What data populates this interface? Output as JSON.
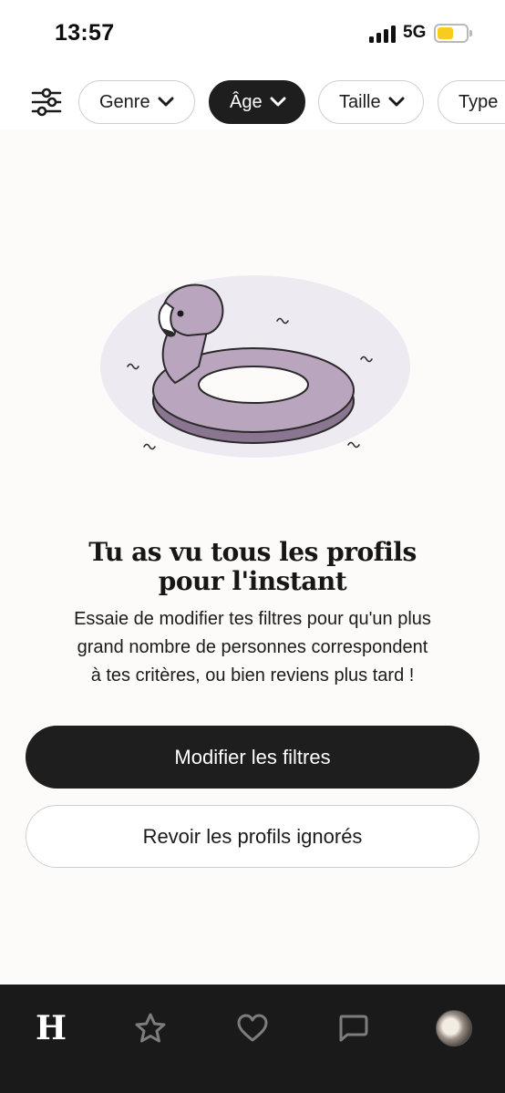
{
  "status_bar": {
    "time": "13:57",
    "network": "5G",
    "battery_level": 0.55,
    "battery_color": "#f6cc1d"
  },
  "filters": {
    "settings_icon": "sliders-icon",
    "chips": [
      {
        "label": "Genre",
        "active": false
      },
      {
        "label": "Âge",
        "active": true
      },
      {
        "label": "Taille",
        "active": false
      },
      {
        "label": "Type",
        "active": false
      }
    ]
  },
  "empty_state": {
    "illustration": "flamingo-float-illustration",
    "headline_line1": "Tu as vu tous les profils",
    "headline_line2": "pour l'instant",
    "body_line1": "Essaie de modifier tes filtres pour qu'un plus",
    "body_line2": "grand nombre de personnes correspondent",
    "body_line3": "à tes critères, ou bien reviens plus tard !",
    "primary_button": "Modifier les filtres",
    "secondary_button": "Revoir les profils ignorés"
  },
  "bottom_nav": {
    "items": [
      {
        "icon": "hinge-logo-icon",
        "glyph": "H"
      },
      {
        "icon": "star-icon"
      },
      {
        "icon": "heart-icon"
      },
      {
        "icon": "chat-icon"
      },
      {
        "icon": "profile-avatar"
      }
    ]
  },
  "colors": {
    "background": "#fcfbfa",
    "dark": "#1e1e1e",
    "flamingo": "#b9a5bd"
  }
}
